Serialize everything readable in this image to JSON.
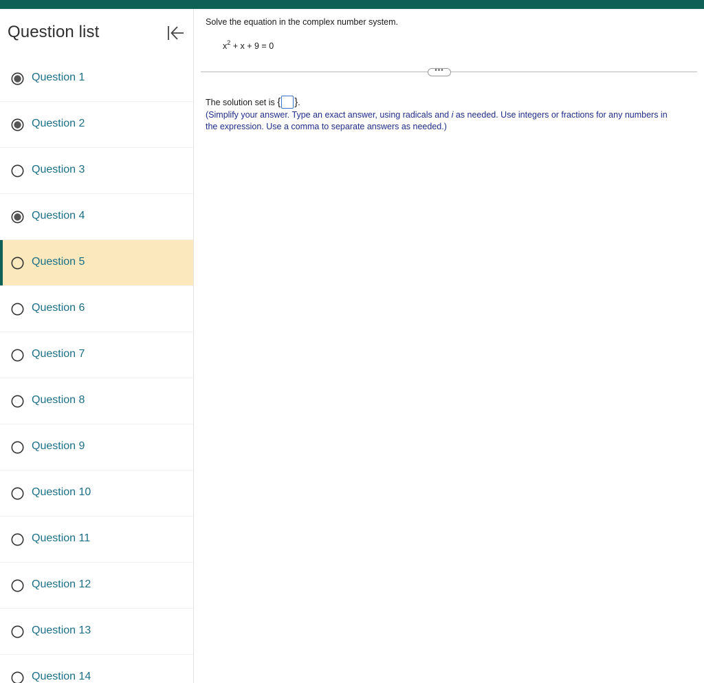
{
  "sidebar": {
    "title": "Question list",
    "collapse_icon": "collapse-left-icon",
    "questions": [
      {
        "label": "Question 1",
        "status": "answered"
      },
      {
        "label": "Question 2",
        "status": "answered"
      },
      {
        "label": "Question 3",
        "status": "unanswered"
      },
      {
        "label": "Question 4",
        "status": "answered"
      },
      {
        "label": "Question 5",
        "status": "current"
      },
      {
        "label": "Question 6",
        "status": "unanswered"
      },
      {
        "label": "Question 7",
        "status": "unanswered"
      },
      {
        "label": "Question 8",
        "status": "unanswered"
      },
      {
        "label": "Question 9",
        "status": "unanswered"
      },
      {
        "label": "Question 10",
        "status": "unanswered"
      },
      {
        "label": "Question 11",
        "status": "unanswered"
      },
      {
        "label": "Question 12",
        "status": "unanswered"
      },
      {
        "label": "Question 13",
        "status": "unanswered"
      },
      {
        "label": "Question 14",
        "status": "unanswered"
      }
    ]
  },
  "problem": {
    "instruction": "Solve the equation in the complex number system.",
    "equation_base": "x",
    "equation_exponent": "2",
    "equation_rest": " + x + 9 = 0",
    "more_label": "•••",
    "answer_prefix": "The solution set is ",
    "answer_open_brace": "{",
    "answer_close_brace": "}",
    "answer_suffix": ".",
    "answer_value": "",
    "hint_part1": "(Simplify your answer. Type an exact answer, using radicals and ",
    "hint_italic": "i",
    "hint_part2": " as needed. Use integers or fractions for any numbers in the expression. Use a comma to separate answers as needed.)"
  },
  "colors": {
    "brand": "#0f6157",
    "current_highlight": "#fbe9bd",
    "question_link": "#1b6f86",
    "hint_text": "#1f2d8a",
    "answer_box_border": "#3b74c9"
  }
}
